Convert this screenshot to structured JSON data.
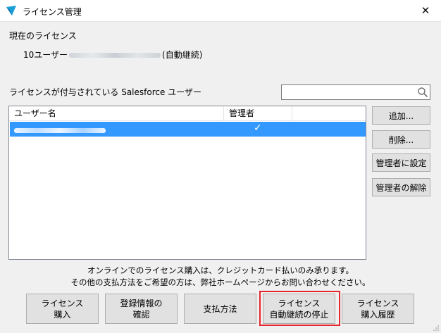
{
  "window": {
    "title": "ライセンス管理",
    "close_label": "✕"
  },
  "current_license": {
    "heading": "現在のライセンス",
    "prefix": "10ユーザー",
    "suffix": "(自動継続)"
  },
  "users_section": {
    "label": "ライセンスが付与されている Salesforce ユーザー",
    "search_value": "",
    "columns": [
      "ユーザー名",
      "管理者"
    ],
    "rows": [
      {
        "admin_mark": "✓",
        "selected": true
      }
    ]
  },
  "side_buttons": {
    "add": "追加...",
    "delete": "削除...",
    "set_admin": "管理者に設定",
    "remove_admin": "管理者の解除"
  },
  "notes": [
    "オンラインでのライセンス購入は、クレジットカード払いのみ承ります。",
    "その他の支払方法をご希望の方は、弊社ホームページからお問い合わせください。"
  ],
  "bottom_buttons": [
    {
      "line1": "ライセンス",
      "line2": "購入"
    },
    {
      "line1": "登録情報の",
      "line2": "確認"
    },
    {
      "line1": "支払方法",
      "line2": ""
    },
    {
      "line1": "ライセンス",
      "line2": "自動継続の停止"
    },
    {
      "line1": "ライセンス",
      "line2": "購入履歴"
    }
  ],
  "colors": {
    "selection": "#3399ff",
    "highlight": "#e6262d",
    "button_face": "#e1e1e1"
  }
}
